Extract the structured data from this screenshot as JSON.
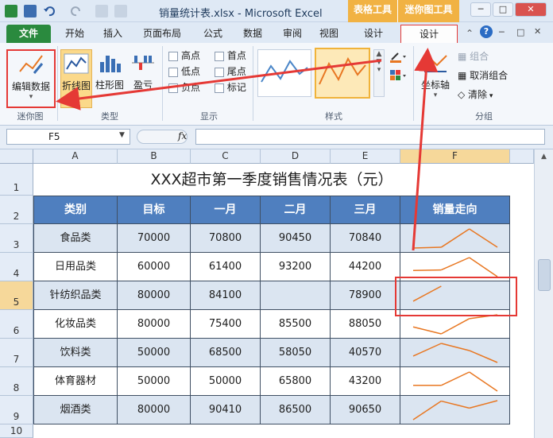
{
  "window": {
    "title": "销量统计表.xlsx - Microsoft Excel",
    "context_tab_table": "表格工具",
    "context_tab_sparkline": "迷你图工具",
    "btn_minimize": "─",
    "btn_restore": "□",
    "btn_close": "✕"
  },
  "ribbon_tabs": [
    "文件",
    "开始",
    "插入",
    "页面布局",
    "公式",
    "数据",
    "审阅",
    "视图",
    "设计",
    "设计"
  ],
  "ribbon": {
    "sparkline_group": {
      "edit_data": "编辑数据",
      "label": "迷你图"
    },
    "type_group": {
      "line": "折线图",
      "column": "柱形图",
      "winloss": "盈亏",
      "label": "类型"
    },
    "show_group": {
      "high": "高点",
      "first": "首点",
      "low": "低点",
      "last": "尾点",
      "negative": "负点",
      "markers": "标记",
      "label": "显示"
    },
    "style_group": {
      "label": "样式"
    },
    "group_group": {
      "axis": "坐标轴",
      "group": "组合",
      "ungroup": "取消组合",
      "clear": "清除",
      "label": "分组"
    }
  },
  "formula_bar": {
    "name_box": "F5",
    "fx": "fx",
    "value": ""
  },
  "columns": [
    "A",
    "B",
    "C",
    "D",
    "E",
    "F"
  ],
  "rows": [
    "1",
    "2",
    "3",
    "4",
    "5",
    "6",
    "7",
    "8",
    "9",
    "10"
  ],
  "sheet": {
    "title": "XXX超市第一季度销售情况表（元）",
    "headers": [
      "类别",
      "目标",
      "一月",
      "二月",
      "三月",
      "销量走向"
    ],
    "data": [
      [
        "食品类",
        "70000",
        "70800",
        "90450",
        "70840"
      ],
      [
        "日用品类",
        "60000",
        "61400",
        "93200",
        "44200"
      ],
      [
        "针纺织品类",
        "80000",
        "84100",
        "",
        "78900"
      ],
      [
        "化妆品类",
        "80000",
        "75400",
        "85500",
        "88050"
      ],
      [
        "饮料类",
        "50000",
        "68500",
        "58050",
        "40570"
      ],
      [
        "体育器材",
        "50000",
        "50000",
        "65800",
        "43200"
      ],
      [
        "烟酒类",
        "80000",
        "90410",
        "86500",
        "90650"
      ]
    ]
  },
  "colors": {
    "header_fill": "#4f7fbf",
    "band_fill": "#dbe5f1",
    "spark": "#e87722",
    "highlight": "#e53935",
    "file_tab": "#2a8a3e",
    "context_tab": "#f1b243"
  }
}
